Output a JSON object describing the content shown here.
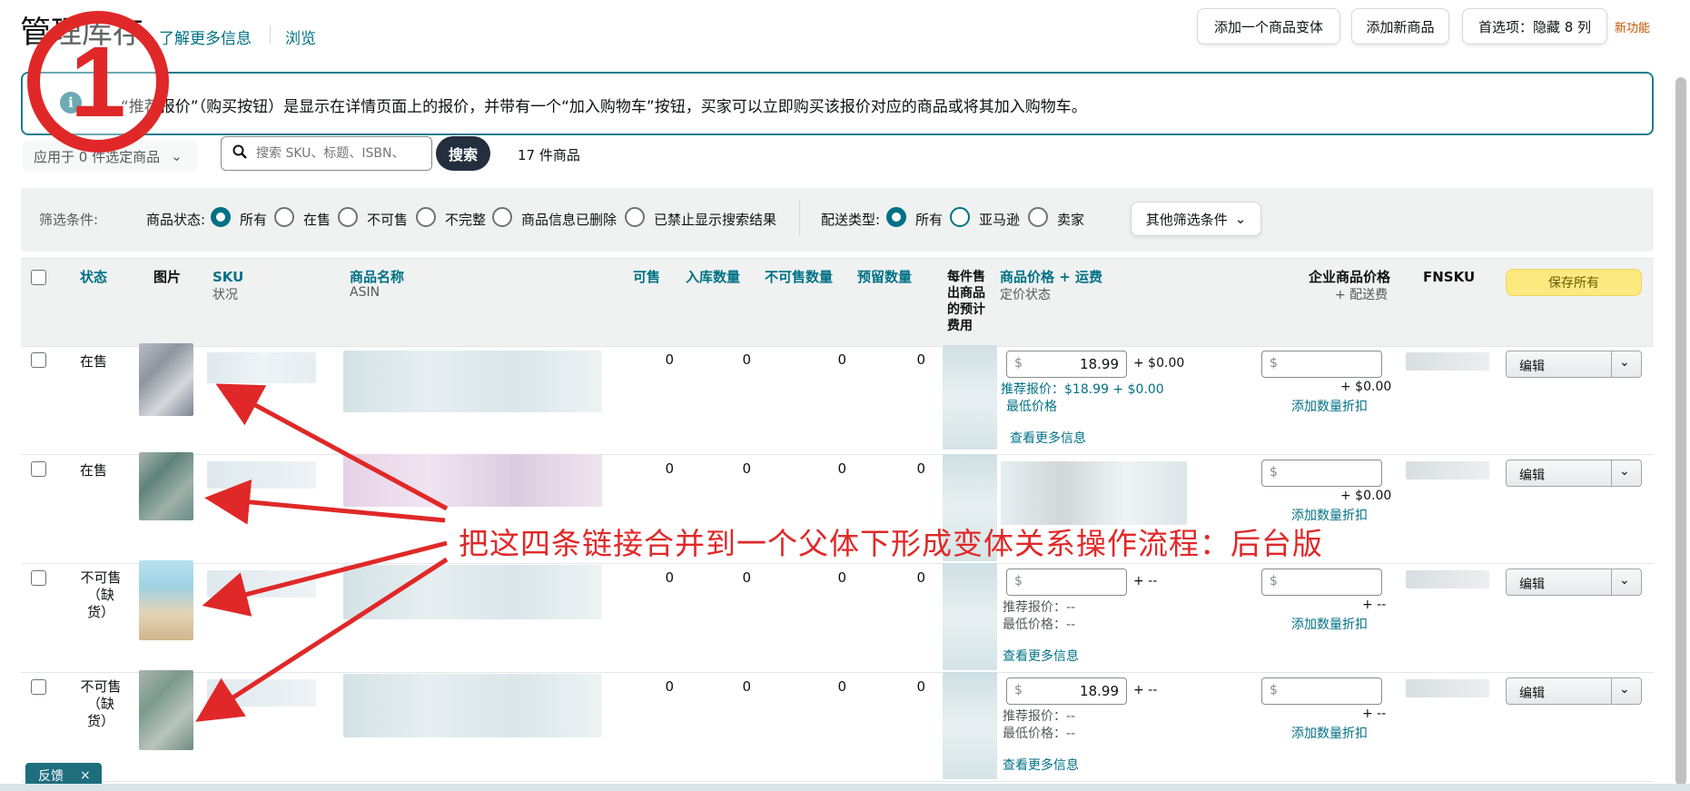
{
  "header": {
    "title": "管理库存",
    "learn_more": "了解更多信息",
    "browse": "浏览",
    "buttons": {
      "add_variation": "添加一个商品变体",
      "add_product": "添加新商品",
      "preferences": "首选项：隐藏 8 列"
    },
    "new_feature": "新功能"
  },
  "info_banner": {
    "icon": "i",
    "text": "“推荐报价”（购买按钮）是显示在详情页面上的报价，并带有一个“加入购物车”按钮，买家可以立即购买该报价对应的商品或将其加入购物车。"
  },
  "step_badge": "1",
  "toolbar": {
    "apply_selected": "应用于 0 件选定商品",
    "search_placeholder": "搜索 SKU、标题、ISBN、",
    "search_button": "搜索",
    "item_count": "17 件商品"
  },
  "filters": {
    "label": "筛选条件:",
    "status_label": "商品状态:",
    "status_options": [
      "所有",
      "在售",
      "不可售",
      "不完整",
      "商品信息已删除",
      "已禁止显示搜索结果"
    ],
    "status_selected": "所有",
    "shipping_label": "配送类型:",
    "shipping_options": [
      "所有",
      "亚马逊",
      "卖家"
    ],
    "shipping_selected": "所有",
    "other": "其他筛选条件"
  },
  "table": {
    "headers": {
      "status": "状态",
      "image": "图片",
      "sku": "SKU",
      "sku_sub": "状况",
      "name": "商品名称",
      "name_sub": "ASIN",
      "available": "可售",
      "inbound": "入库数量",
      "unfulfillable": "不可售数量",
      "reserved": "预留数量",
      "fee": "每件售出商品的预计费用",
      "price": "商品价格 + 运费",
      "price_sub": "定价状态",
      "business_price": "企业商品价格",
      "business_sub": "+ 配送费",
      "fnsku": "FNSKU",
      "save_all": "保存所有"
    },
    "rows": [
      {
        "status": "在售",
        "available": "0",
        "inbound": "0",
        "unfulfillable": "0",
        "reserved": "0",
        "price": "18.99",
        "shipping": "+ $0.00",
        "featured": "推荐报价：$18.99 + $0.00",
        "lowest": "最低价格",
        "more": "查看更多信息",
        "biz_ship": "+ $0.00",
        "qty_discount": "添加数量折扣",
        "edit": "编辑"
      },
      {
        "status": "在售",
        "available": "0",
        "inbound": "0",
        "unfulfillable": "0",
        "reserved": "0",
        "biz_ship": "+ $0.00",
        "qty_discount": "添加数量折扣",
        "edit": "编辑"
      },
      {
        "status": "不可售（缺货）",
        "available": "0",
        "inbound": "0",
        "unfulfillable": "0",
        "reserved": "0",
        "shipping": "+ --",
        "featured": "推荐报价：--",
        "lowest": "最低价格：--",
        "more": "查看更多信息",
        "biz_ship": "+ --",
        "qty_discount": "添加数量折扣",
        "edit": "编辑"
      },
      {
        "status": "不可售（缺货）",
        "available": "0",
        "inbound": "0",
        "unfulfillable": "0",
        "reserved": "0",
        "price": "18.99",
        "shipping": "+ --",
        "featured": "推荐报价：--",
        "lowest": "最低价格：--",
        "more": "查看更多信息",
        "biz_ship": "+ --",
        "qty_discount": "添加数量折扣",
        "edit": "编辑"
      }
    ],
    "currency_symbol": "$"
  },
  "annotation": "把这四条链接合并到一个父体下形成变体关系操作流程：后台版",
  "feedback": {
    "label": "反馈",
    "close": "×"
  },
  "colors": {
    "accent": "#007185",
    "annotation_red": "#e02828",
    "save_yellow": "#fce97f"
  }
}
